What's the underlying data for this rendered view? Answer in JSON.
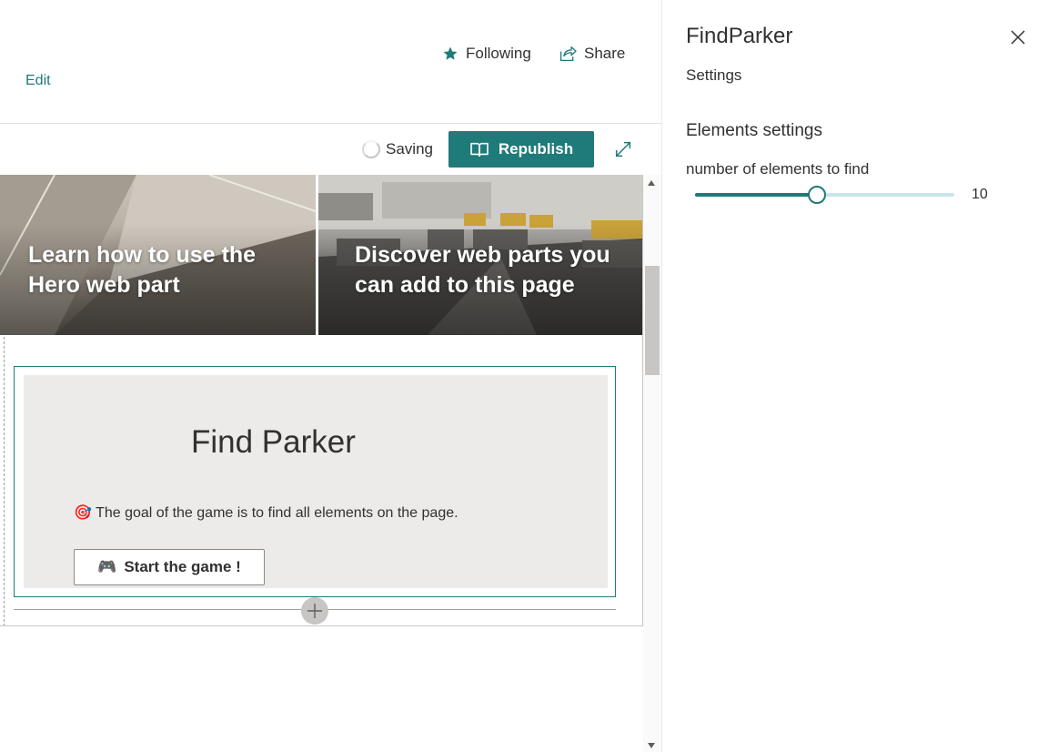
{
  "header": {
    "edit_label": "Edit",
    "following_label": "Following",
    "share_label": "Share"
  },
  "toolbar": {
    "saving_label": "Saving",
    "republish_label": "Republish"
  },
  "hero": {
    "tiles": [
      {
        "title": "Learn how to use the Hero web part"
      },
      {
        "title": "Discover web parts you can add to this page"
      }
    ]
  },
  "game": {
    "title": "Find Parker",
    "description": "The goal of the game is to find all elements on the page.",
    "description_emoji": "🎯",
    "start_label": "Start the game !",
    "start_emoji": "🎮"
  },
  "pane": {
    "title": "FindParker",
    "subtitle": "Settings",
    "group_title": "Elements settings",
    "slider_label": "number of elements to find",
    "slider_value": "10",
    "slider_fraction": 0.47
  },
  "colors": {
    "accent": "#1f7a7a",
    "slider_track": "#c8e6ea",
    "game_bg": "#edebe9"
  },
  "icons": {
    "following": "star-icon",
    "share": "share-icon",
    "republish": "book-icon",
    "expand": "expand-icon",
    "close": "close-icon",
    "add": "plus-icon"
  }
}
